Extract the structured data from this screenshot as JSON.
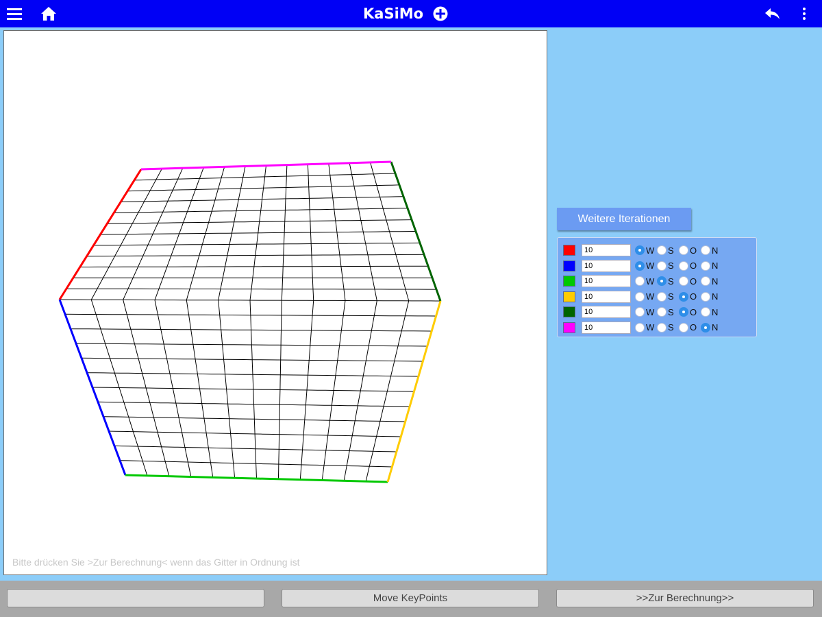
{
  "header": {
    "title": "KaSiMo",
    "menu_icon": "hamburger-menu-icon",
    "home_icon": "home-icon",
    "add_icon": "plus-circle-icon",
    "back_icon": "reply-arrow-icon",
    "more_icon": "more-vertical-icon",
    "bar_color": "#0000f5"
  },
  "canvas": {
    "hint": "Bitte drücken Sie >Zur Berechnung< wenn das Gitter in Ordnung ist",
    "edge_colors": [
      "#ff0000",
      "#0000ff",
      "#00c800",
      "#ffcc00",
      "#006400",
      "#ff00ff"
    ]
  },
  "panel": {
    "button_label": "Weitere Iterationen",
    "direction_labels": [
      "W",
      "S",
      "O",
      "N"
    ],
    "rows": [
      {
        "color": "#ff0000",
        "value": "10",
        "selected": "W"
      },
      {
        "color": "#0000ff",
        "value": "10",
        "selected": "W"
      },
      {
        "color": "#00c800",
        "value": "10",
        "selected": "S"
      },
      {
        "color": "#ffcc00",
        "value": "10",
        "selected": "O"
      },
      {
        "color": "#006400",
        "value": "10",
        "selected": "O"
      },
      {
        "color": "#ff00ff",
        "value": "10",
        "selected": "N"
      }
    ]
  },
  "footer": {
    "left_label": "",
    "middle_label": "Move KeyPoints",
    "right_label": ">>Zur Berechnung>>"
  }
}
